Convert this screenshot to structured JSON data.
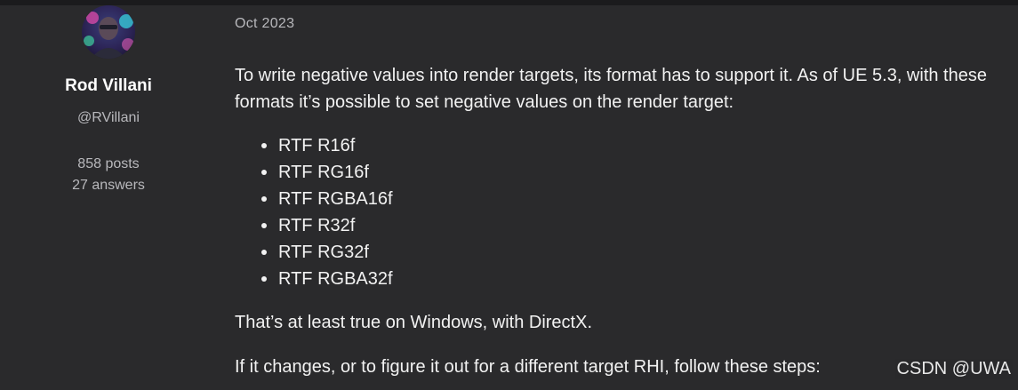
{
  "post": {
    "date": "Oct 2023",
    "paragraph_1": "To write negative values into render targets, its format has to support it. As of UE 5.3, with these formats it’s possible to set negative values on the render target:",
    "formats": [
      "RTF R16f",
      "RTF RG16f",
      "RTF RGBA16f",
      "RTF R32f",
      "RTF RG32f",
      "RTF RGBA32f"
    ],
    "paragraph_2": "That’s at least true on Windows, with DirectX.",
    "paragraph_3": "If it changes, or to figure it out for a different target RHI, follow these steps:"
  },
  "author": {
    "name": "Rod Villani",
    "handle": "@RVillani",
    "posts": "858 posts",
    "answers": "27 answers",
    "avatar_icon": "avatar-portrait-icon"
  },
  "watermark": "CSDN @UWA",
  "colors": {
    "background": "#2a2a2c",
    "top_strip": "#1b1b1d",
    "muted_text": "#b8b8bc",
    "body_text": "#f2f2f2"
  }
}
